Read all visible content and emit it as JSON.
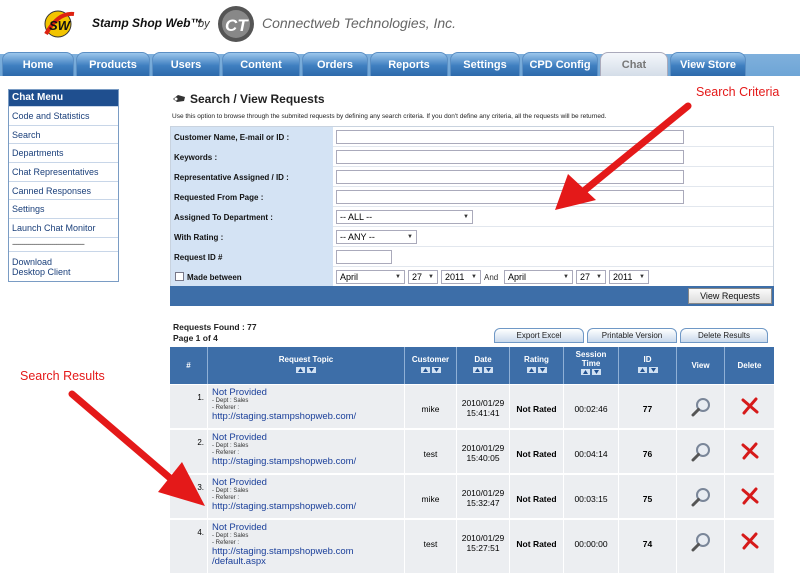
{
  "header": {
    "brand": "Stamp Shop Web™",
    "by": "by",
    "company": "Connectweb Technologies, Inc."
  },
  "nav": {
    "tabs": [
      {
        "label": "Home",
        "active": false
      },
      {
        "label": "Products",
        "active": false
      },
      {
        "label": "Users",
        "active": false
      },
      {
        "label": "Content",
        "active": false
      },
      {
        "label": "Orders",
        "active": false
      },
      {
        "label": "Reports",
        "active": false
      },
      {
        "label": "Settings",
        "active": false
      },
      {
        "label": "CPD Config",
        "active": false
      },
      {
        "label": "Chat",
        "active": true
      },
      {
        "label": "View Store",
        "active": false
      }
    ]
  },
  "sidebar": {
    "title": "Chat Menu",
    "items": [
      {
        "label": "Code and Statistics"
      },
      {
        "label": "Search"
      },
      {
        "label": "Departments"
      },
      {
        "label": "Chat Representatives"
      },
      {
        "label": "Canned Responses"
      },
      {
        "label": "Settings"
      },
      {
        "label": "Launch Chat Monitor"
      }
    ],
    "separator": "------------------------------------",
    "download": {
      "line1": "Download",
      "line2": "Desktop Client"
    }
  },
  "search": {
    "title": "Search / View Requests",
    "description": "Use this option to browse through the submited requests by defining any search criteria. If you don't define any criteria, all the requests will be returned.",
    "fields": {
      "customer": {
        "label": "Customer Name, E-mail or ID :",
        "value": ""
      },
      "keywords": {
        "label": "Keywords :",
        "value": ""
      },
      "rep": {
        "label": "Representative Assigned / ID :",
        "value": ""
      },
      "from_page": {
        "label": "Requested From Page :",
        "value": ""
      },
      "department": {
        "label": "Assigned To Department :",
        "selected": "-- ALL --"
      },
      "rating": {
        "label": "With Rating :",
        "selected": "-- ANY --"
      },
      "request_id": {
        "label": "Request ID #",
        "value": ""
      },
      "made_between": {
        "label": "Made between",
        "checked": false,
        "from": {
          "month": "April",
          "day": "27",
          "year": "2011"
        },
        "and": "And",
        "to": {
          "month": "April",
          "day": "27",
          "year": "2011"
        }
      }
    },
    "submit_label": "View Requests"
  },
  "results": {
    "found": "Requests Found : 77",
    "page": "Page 1 of 4",
    "buttons": {
      "export": "Export Excel",
      "printable": "Printable Version",
      "delete": "Delete Results"
    },
    "columns": {
      "num": "#",
      "topic": "Request Topic",
      "customer": "Customer",
      "date": "Date",
      "rating": "Rating",
      "session_line1": "Session",
      "session_line2": "Time",
      "id": "ID",
      "view": "View",
      "delete": "Delete"
    },
    "rows": [
      {
        "num": "1.",
        "topic": "Not Provided",
        "dept": "- Dept : Sales",
        "referer": "- Referer :",
        "url": "http://staging.stampshopweb.com/",
        "url2": "",
        "customer": "mike",
        "date": "2010/01/29",
        "time": "15:41:41",
        "rating": "Not Rated",
        "session": "00:02:46",
        "id": "77"
      },
      {
        "num": "2.",
        "topic": "Not Provided",
        "dept": "- Dept : Sales",
        "referer": "- Referer :",
        "url": "http://staging.stampshopweb.com/",
        "url2": "",
        "customer": "test",
        "date": "2010/01/29",
        "time": "15:40:05",
        "rating": "Not Rated",
        "session": "00:04:14",
        "id": "76"
      },
      {
        "num": "3.",
        "topic": "Not Provided",
        "dept": "- Dept : Sales",
        "referer": "- Referer :",
        "url": "http://staging.stampshopweb.com/",
        "url2": "",
        "customer": "mike",
        "date": "2010/01/29",
        "time": "15:32:47",
        "rating": "Not Rated",
        "session": "00:03:15",
        "id": "75"
      },
      {
        "num": "4.",
        "topic": "Not Provided",
        "dept": "- Dept : Sales",
        "referer": "- Referer :",
        "url": "http://staging.stampshopweb.com",
        "url2": "/default.aspx",
        "customer": "test",
        "date": "2010/01/29",
        "time": "15:27:51",
        "rating": "Not Rated",
        "session": "00:00:00",
        "id": "74"
      }
    ]
  },
  "annotations": {
    "criteria": "Search Criteria",
    "results": "Search Results",
    "color": "#e41919"
  }
}
